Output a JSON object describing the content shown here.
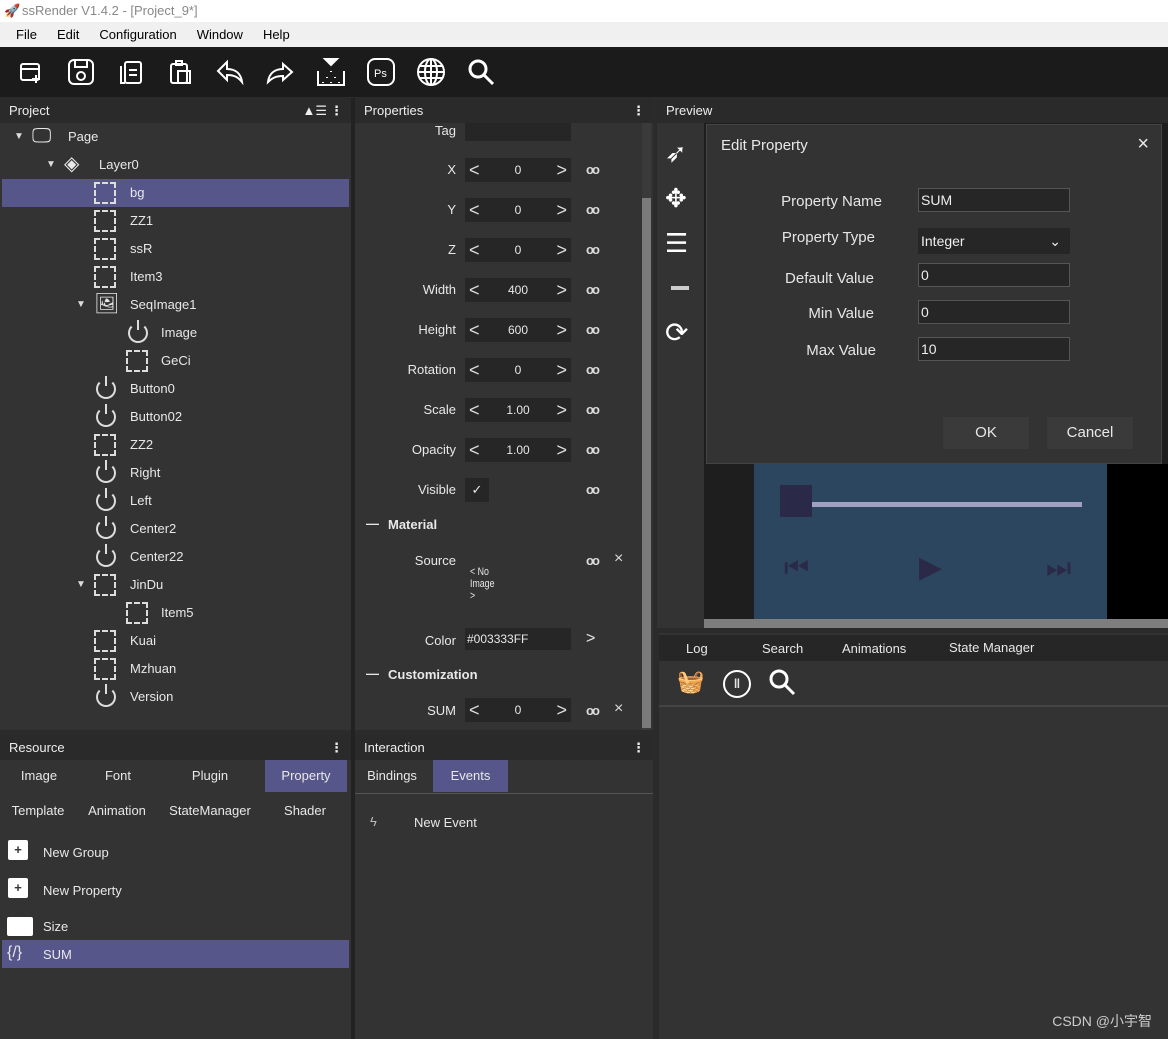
{
  "window": {
    "title": "ssRender V1.4.2 - [Project_9*]"
  },
  "menu": [
    "File",
    "Edit",
    "Configuration",
    "Window",
    "Help"
  ],
  "toolbar": [
    "new-icon",
    "save-icon",
    "copy-icon",
    "paste-icon",
    "undo-icon",
    "redo-icon",
    "export-icon",
    "photoshop-icon",
    "globe-icon",
    "search-icon"
  ],
  "project": {
    "title": "Project",
    "tree": [
      {
        "label": "Page",
        "level": 0,
        "icon": "monitor",
        "expand": true
      },
      {
        "label": "Layer0",
        "level": 1,
        "icon": "layers",
        "expand": true
      },
      {
        "label": "bg",
        "level": 2,
        "icon": "dash",
        "selected": true
      },
      {
        "label": "ZZ1",
        "level": 2,
        "icon": "dash"
      },
      {
        "label": "ssR",
        "level": 2,
        "icon": "dash"
      },
      {
        "label": "Item3",
        "level": 2,
        "icon": "dash"
      },
      {
        "label": "SeqImage1",
        "level": 2,
        "icon": "image",
        "expand": true
      },
      {
        "label": "Image",
        "level": 3,
        "icon": "power"
      },
      {
        "label": "GeCi",
        "level": 3,
        "icon": "dash"
      },
      {
        "label": "Button0",
        "level": 2,
        "icon": "power"
      },
      {
        "label": "Button02",
        "level": 2,
        "icon": "power"
      },
      {
        "label": "ZZ2",
        "level": 2,
        "icon": "dash"
      },
      {
        "label": "Right",
        "level": 2,
        "icon": "power"
      },
      {
        "label": "Left",
        "level": 2,
        "icon": "power"
      },
      {
        "label": "Center2",
        "level": 2,
        "icon": "power"
      },
      {
        "label": "Center22",
        "level": 2,
        "icon": "power"
      },
      {
        "label": "JinDu",
        "level": 2,
        "icon": "dash",
        "expand": true
      },
      {
        "label": "Item5",
        "level": 3,
        "icon": "dash"
      },
      {
        "label": "Kuai",
        "level": 2,
        "icon": "dash"
      },
      {
        "label": "Mzhuan",
        "level": 2,
        "icon": "dash"
      },
      {
        "label": "Version",
        "level": 2,
        "icon": "power"
      }
    ]
  },
  "properties": {
    "title": "Properties",
    "tag_label": "Tag",
    "tag_value": "",
    "rows": [
      {
        "label": "X",
        "value": "0"
      },
      {
        "label": "Y",
        "value": "0"
      },
      {
        "label": "Z",
        "value": "0"
      },
      {
        "label": "Width",
        "value": "400"
      },
      {
        "label": "Height",
        "value": "600"
      },
      {
        "label": "Rotation",
        "value": "0"
      },
      {
        "label": "Scale",
        "value": "1.00"
      },
      {
        "label": "Opacity",
        "value": "1.00"
      }
    ],
    "visible_label": "Visible",
    "visible_checked": true,
    "material_heading": "Material",
    "source_label": "Source",
    "source_value": "< No Image >",
    "color_label": "Color",
    "color_value": "#003333FF",
    "custom_heading": "Customization",
    "sum_label": "SUM",
    "sum_value": "0"
  },
  "preview": {
    "title": "Preview",
    "slider_value": 0
  },
  "dialog": {
    "title": "Edit Property",
    "name_label": "Property Name",
    "name_value": "SUM",
    "type_label": "Property Type",
    "type_value": "Integer",
    "default_label": "Default Value",
    "default_value": "0",
    "min_label": "Min Value",
    "min_value": "0",
    "max_label": "Max Value",
    "max_value": "10",
    "ok": "OK",
    "cancel": "Cancel"
  },
  "resource": {
    "title": "Resource",
    "tabs": [
      "Image",
      "Font",
      "Plugin",
      "Property",
      "Template",
      "Animation",
      "StateManager",
      "Shader"
    ],
    "active_tab": "Property",
    "items": [
      {
        "label": "New Group",
        "icon": "plus"
      },
      {
        "label": "New Property",
        "icon": "plus"
      },
      {
        "label": "Size",
        "icon": "folder"
      },
      {
        "label": "SUM",
        "icon": "variable",
        "selected": true
      }
    ]
  },
  "interaction": {
    "title": "Interaction",
    "tabs": [
      "Bindings",
      "Events"
    ],
    "active_tab": "Events",
    "new_event": "New Event"
  },
  "log": {
    "tabs": [
      "Log",
      "Search",
      "Animations",
      "State Manager"
    ]
  },
  "watermark": "CSDN @小宇智",
  "colors": {
    "selected": "#56568a",
    "preview_bg": "#2c4660"
  }
}
